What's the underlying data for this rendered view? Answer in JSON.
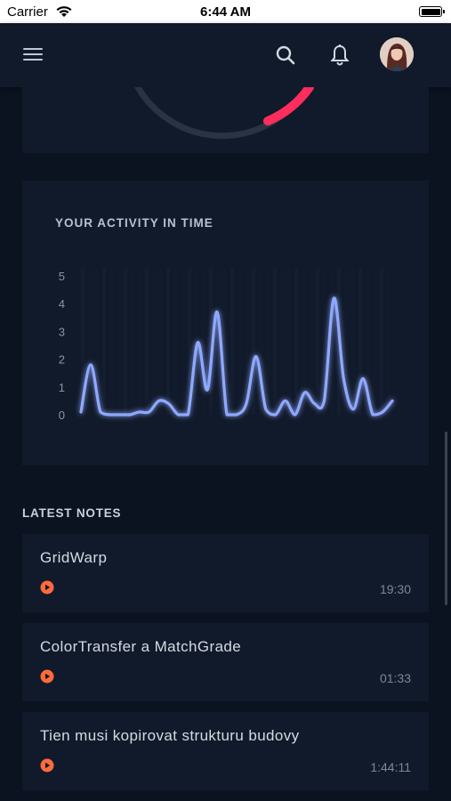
{
  "status_bar": {
    "carrier": "Carrier",
    "time": "6:44 AM"
  },
  "header": {
    "icons": [
      "menu-icon",
      "search-icon",
      "bell-icon"
    ],
    "avatar": "user-avatar"
  },
  "gauge": {
    "track_color": "#2a3344",
    "accent_color": "#ff2d5e"
  },
  "activity": {
    "title": "YOUR ACTIVITY IN TIME",
    "line_color": "#8fa8ff"
  },
  "chart_data": {
    "type": "line",
    "y_ticks": [
      "0",
      "1",
      "2",
      "3",
      "4",
      "5"
    ],
    "ylim": [
      0,
      5
    ],
    "grid": false,
    "series": [
      {
        "values": [
          0.1,
          1.8,
          0.1,
          0,
          0,
          0,
          0.1,
          0.1,
          0.5,
          0.4,
          0,
          0,
          2.6,
          0.9,
          3.7,
          0,
          0,
          0.4,
          2.1,
          0.2,
          0,
          0.5,
          0,
          0.8,
          0.4,
          0.5,
          4.2,
          1.3,
          0.2,
          1.3,
          0,
          0.1,
          0.5
        ]
      }
    ]
  },
  "latest_notes": {
    "title": "LATEST NOTES",
    "accent_color": "#ff6a3d",
    "items": [
      {
        "title": "GridWarp",
        "duration": "19:30"
      },
      {
        "title": "ColorTransfer a MatchGrade",
        "duration": "01:33"
      },
      {
        "title": "Tien musi kopirovat strukturu budovy",
        "duration": "1:44:11"
      }
    ]
  }
}
